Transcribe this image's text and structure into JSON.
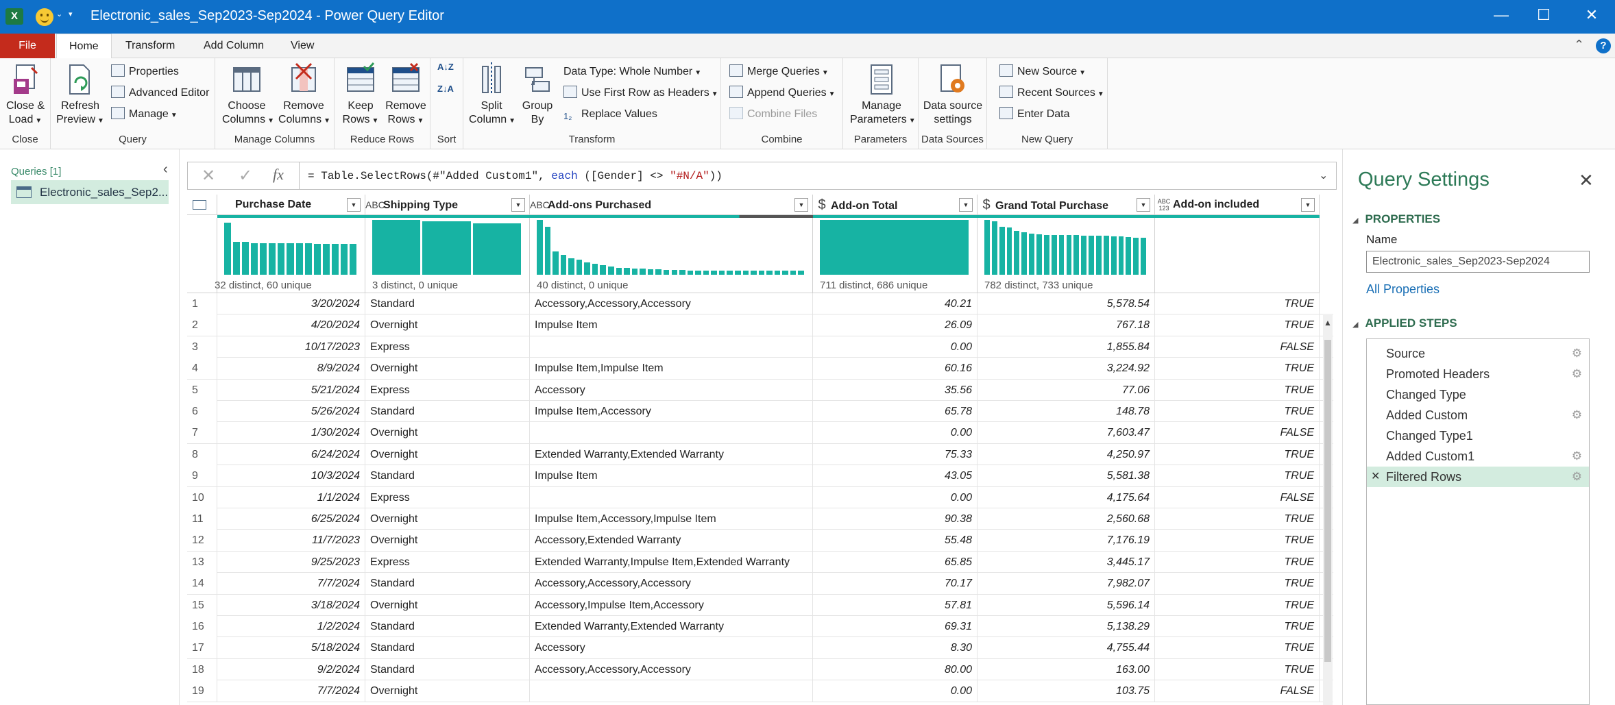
{
  "titlebar": {
    "app_icon": "X",
    "title": "Electronic_sales_Sep2023-Sep2024 - Power Query Editor",
    "qa_dropdown": "⌄",
    "qa_customize": "▾",
    "minimize": "—",
    "maximize": "☐",
    "close": "✕"
  },
  "tabs": {
    "file": "File",
    "home": "Home",
    "transform": "Transform",
    "add_column": "Add Column",
    "view": "View",
    "collapse": "⌃",
    "help": "?"
  },
  "ribbon": {
    "close_load": {
      "label1": "Close &",
      "label2": "Load",
      "group": "Close"
    },
    "refresh_preview": {
      "label1": "Refresh",
      "label2": "Preview"
    },
    "properties": "Properties",
    "advanced_editor": "Advanced Editor",
    "manage": "Manage",
    "query_group": "Query",
    "choose_columns": {
      "label1": "Choose",
      "label2": "Columns"
    },
    "remove_columns": {
      "label1": "Remove",
      "label2": "Columns"
    },
    "manage_columns_group": "Manage Columns",
    "keep_rows": {
      "label1": "Keep",
      "label2": "Rows"
    },
    "remove_rows": {
      "label1": "Remove",
      "label2": "Rows"
    },
    "reduce_rows_group": "Reduce Rows",
    "sort_group": "Sort",
    "sort_asc": "A↓Z",
    "sort_desc": "Z↓A",
    "split_column": {
      "label1": "Split",
      "label2": "Column"
    },
    "group_by": {
      "label1": "Group",
      "label2": "By"
    },
    "data_type": "Data Type: Whole Number",
    "first_row_headers": "Use First Row as Headers",
    "replace_values": "Replace Values",
    "transform_group": "Transform",
    "merge_queries": "Merge Queries",
    "append_queries": "Append Queries",
    "combine_files": "Combine Files",
    "combine_group": "Combine",
    "manage_parameters": {
      "label1": "Manage",
      "label2": "Parameters"
    },
    "parameters_group": "Parameters",
    "data_source_settings": {
      "label1": "Data source",
      "label2": "settings"
    },
    "data_sources_group": "Data Sources",
    "new_source": "New Source",
    "recent_sources": "Recent Sources",
    "enter_data": "Enter Data",
    "new_query_group": "New Query"
  },
  "queries_pane": {
    "header": "Queries [1]",
    "collapse": "‹",
    "item": "Electronic_sales_Sep2..."
  },
  "formula_bar": {
    "cancel": "✕",
    "commit": "✓",
    "fx": "fx",
    "prefix": "= Table.SelectRows(#\"Added Custom1\", ",
    "kw_each": "each",
    "middle": " ([Gender] <> ",
    "string": "\"#N/A\"",
    "suffix": "))",
    "expand": "⌄"
  },
  "grid": {
    "columns": [
      {
        "name": "Purchase Date",
        "type": "",
        "profile": "32 distinct, 60 unique",
        "bars": [
          0.95,
          0.6,
          0.6,
          0.58,
          0.58,
          0.58,
          0.57,
          0.57,
          0.57,
          0.57,
          0.56,
          0.56,
          0.56,
          0.56,
          0.56
        ],
        "partial": true
      },
      {
        "name": "Shipping Type",
        "type": "ABC",
        "profile": "3 distinct, 0 unique",
        "bars": [
          1.0,
          0.98,
          0.94
        ]
      },
      {
        "name": "Add-ons Purchased",
        "type": "ABC",
        "profile": "40 distinct, 0 unique",
        "bars": [
          1.0,
          0.88,
          0.42,
          0.36,
          0.3,
          0.27,
          0.23,
          0.2,
          0.17,
          0.15,
          0.13,
          0.12,
          0.11,
          0.11,
          0.1,
          0.1,
          0.09,
          0.09,
          0.09,
          0.08,
          0.08,
          0.08,
          0.08,
          0.07,
          0.07,
          0.07,
          0.07,
          0.07,
          0.07,
          0.07,
          0.07,
          0.07,
          0.07,
          0.07
        ]
      },
      {
        "name": "Add-on Total",
        "type": "$",
        "profile": "711 distinct, 686 unique",
        "bars": [
          1.0
        ]
      },
      {
        "name": "Grand Total Purchase",
        "type": "$",
        "profile": "782 distinct, 733 unique",
        "bars": [
          1.0,
          0.97,
          0.88,
          0.86,
          0.8,
          0.78,
          0.75,
          0.74,
          0.73,
          0.73,
          0.72,
          0.72,
          0.72,
          0.71,
          0.71,
          0.71,
          0.71,
          0.7,
          0.7,
          0.69,
          0.68,
          0.67
        ]
      },
      {
        "name": "Add-on included",
        "type": "ABC\n123",
        "profile": "",
        "bars": []
      }
    ],
    "rows": [
      [
        "1",
        "3/20/2024",
        "Standard",
        "Accessory,Accessory,Accessory",
        "40.21",
        "5,578.54",
        "TRUE"
      ],
      [
        "2",
        "4/20/2024",
        "Overnight",
        "Impulse Item",
        "26.09",
        "767.18",
        "TRUE"
      ],
      [
        "3",
        "10/17/2023",
        "Express",
        "",
        "0.00",
        "1,855.84",
        "FALSE"
      ],
      [
        "4",
        "8/9/2024",
        "Overnight",
        "Impulse Item,Impulse Item",
        "60.16",
        "3,224.92",
        "TRUE"
      ],
      [
        "5",
        "5/21/2024",
        "Express",
        "Accessory",
        "35.56",
        "77.06",
        "TRUE"
      ],
      [
        "6",
        "5/26/2024",
        "Standard",
        "Impulse Item,Accessory",
        "65.78",
        "148.78",
        "TRUE"
      ],
      [
        "7",
        "1/30/2024",
        "Overnight",
        "",
        "0.00",
        "7,603.47",
        "FALSE"
      ],
      [
        "8",
        "6/24/2024",
        "Overnight",
        "Extended Warranty,Extended Warranty",
        "75.33",
        "4,250.97",
        "TRUE"
      ],
      [
        "9",
        "10/3/2024",
        "Standard",
        "Impulse Item",
        "43.05",
        "5,581.38",
        "TRUE"
      ],
      [
        "10",
        "1/1/2024",
        "Express",
        "",
        "0.00",
        "4,175.64",
        "FALSE"
      ],
      [
        "11",
        "6/25/2024",
        "Overnight",
        "Impulse Item,Accessory,Impulse Item",
        "90.38",
        "2,560.68",
        "TRUE"
      ],
      [
        "12",
        "11/7/2023",
        "Overnight",
        "Accessory,Extended Warranty",
        "55.48",
        "7,176.19",
        "TRUE"
      ],
      [
        "13",
        "9/25/2023",
        "Express",
        "Extended Warranty,Impulse Item,Extended Warranty",
        "65.85",
        "3,445.17",
        "TRUE"
      ],
      [
        "14",
        "7/7/2024",
        "Standard",
        "Accessory,Accessory,Accessory",
        "70.17",
        "7,982.07",
        "TRUE"
      ],
      [
        "15",
        "3/18/2024",
        "Overnight",
        "Accessory,Impulse Item,Accessory",
        "57.81",
        "5,596.14",
        "TRUE"
      ],
      [
        "16",
        "1/2/2024",
        "Standard",
        "Extended Warranty,Extended Warranty",
        "69.31",
        "5,138.29",
        "TRUE"
      ],
      [
        "17",
        "5/18/2024",
        "Standard",
        "Accessory",
        "8.30",
        "4,755.44",
        "TRUE"
      ],
      [
        "18",
        "9/2/2024",
        "Standard",
        "Accessory,Accessory,Accessory",
        "80.00",
        "163.00",
        "TRUE"
      ],
      [
        "19",
        "7/7/2024",
        "Overnight",
        "",
        "0.00",
        "103.75",
        "FALSE"
      ]
    ]
  },
  "settings_pane": {
    "title": "Query Settings",
    "close": "✕",
    "properties_header": "PROPERTIES",
    "name_label": "Name",
    "name_value": "Electronic_sales_Sep2023-Sep2024",
    "all_properties": "All Properties",
    "applied_steps_header": "APPLIED STEPS",
    "steps": [
      {
        "label": "Source",
        "gear": true
      },
      {
        "label": "Promoted Headers",
        "gear": true
      },
      {
        "label": "Changed Type",
        "gear": false
      },
      {
        "label": "Added Custom",
        "gear": true
      },
      {
        "label": "Changed Type1",
        "gear": false
      },
      {
        "label": "Added Custom1",
        "gear": true
      },
      {
        "label": "Filtered Rows",
        "gear": true,
        "selected": true
      }
    ]
  },
  "colors": {
    "titlebar": "#0f70c9",
    "file_tab": "#c42b1c",
    "profile_bar": "#17b3a3",
    "selection": "#d3ecdf",
    "settings_title": "#2d7a57"
  }
}
